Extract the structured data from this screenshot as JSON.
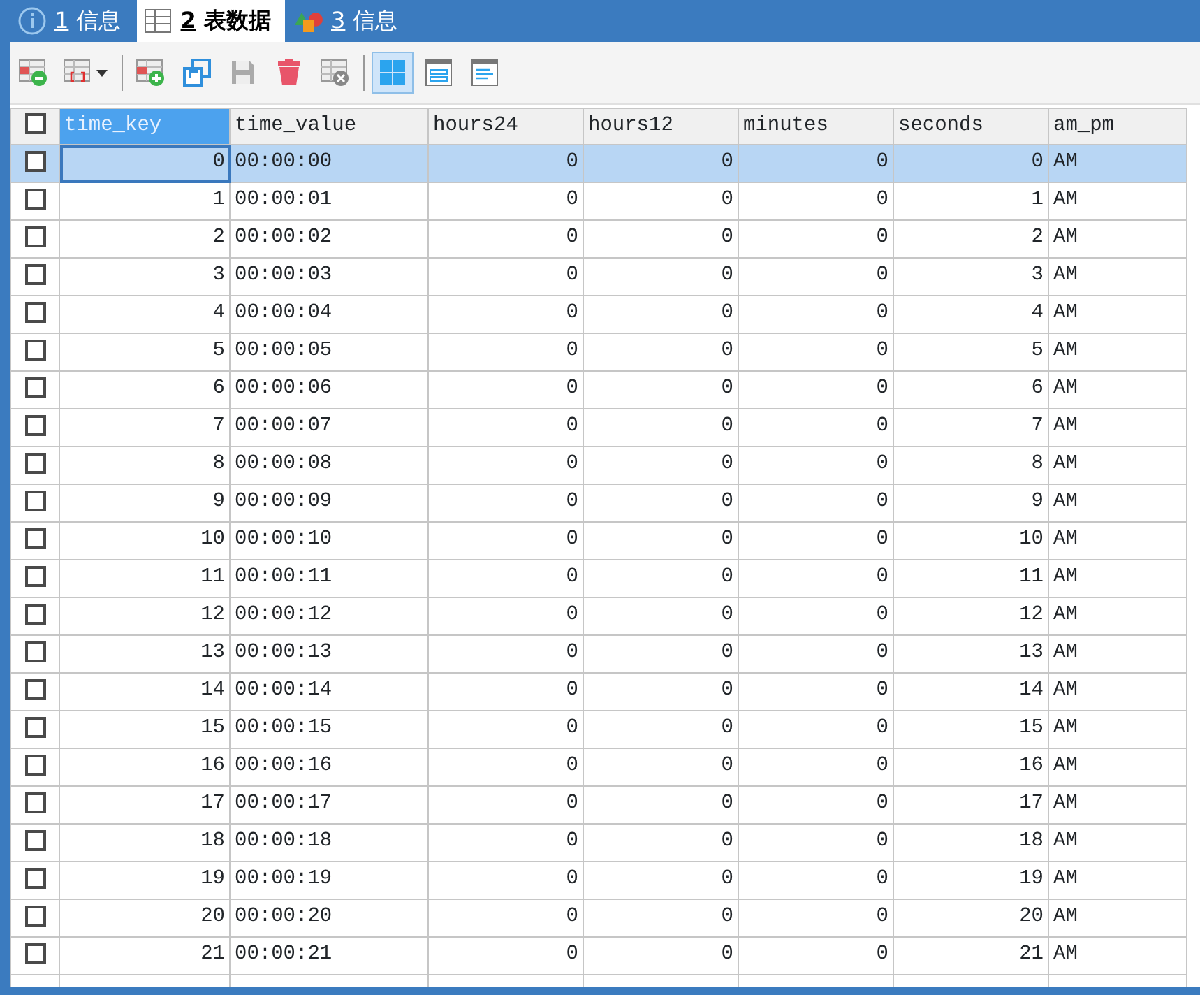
{
  "tabs": [
    {
      "number": "1",
      "label": "信息",
      "kind": "info",
      "selected": false
    },
    {
      "number": "2",
      "label": "表数据",
      "kind": "grid",
      "selected": true
    },
    {
      "number": "3",
      "label": "信息",
      "kind": "shapes",
      "selected": false
    }
  ],
  "toolbar": [
    {
      "kind": "add-record",
      "pressed": false
    },
    {
      "kind": "filter",
      "pressed": false
    },
    {
      "kind": "separator"
    },
    {
      "kind": "add",
      "pressed": false
    },
    {
      "kind": "refresh",
      "pressed": false
    },
    {
      "kind": "save",
      "pressed": false
    },
    {
      "kind": "delete",
      "pressed": false
    },
    {
      "kind": "discard",
      "pressed": false
    },
    {
      "kind": "separator"
    },
    {
      "kind": "grid-view",
      "pressed": true
    },
    {
      "kind": "form-view",
      "pressed": false
    },
    {
      "kind": "text-view",
      "pressed": false
    }
  ],
  "table": {
    "header_checked": false,
    "columns": [
      {
        "label": "time_key",
        "kind": "number",
        "selected": true
      },
      {
        "label": "time_value",
        "kind": "text",
        "selected": false
      },
      {
        "label": "hours24",
        "kind": "number",
        "selected": false
      },
      {
        "label": "hours12",
        "kind": "number",
        "selected": false
      },
      {
        "label": "minutes",
        "kind": "number",
        "selected": false
      },
      {
        "label": "seconds",
        "kind": "number",
        "selected": false
      },
      {
        "label": "am_pm",
        "kind": "text",
        "selected": false
      }
    ],
    "rows": [
      {
        "cells": [
          "0",
          "00:00:00",
          "0",
          "0",
          "0",
          "0",
          "AM"
        ],
        "checked": false,
        "selected": true
      },
      {
        "cells": [
          "1",
          "00:00:01",
          "0",
          "0",
          "0",
          "1",
          "AM"
        ],
        "checked": false,
        "selected": false
      },
      {
        "cells": [
          "2",
          "00:00:02",
          "0",
          "0",
          "0",
          "2",
          "AM"
        ],
        "checked": false,
        "selected": false
      },
      {
        "cells": [
          "3",
          "00:00:03",
          "0",
          "0",
          "0",
          "3",
          "AM"
        ],
        "checked": false,
        "selected": false
      },
      {
        "cells": [
          "4",
          "00:00:04",
          "0",
          "0",
          "0",
          "4",
          "AM"
        ],
        "checked": false,
        "selected": false
      },
      {
        "cells": [
          "5",
          "00:00:05",
          "0",
          "0",
          "0",
          "5",
          "AM"
        ],
        "checked": false,
        "selected": false
      },
      {
        "cells": [
          "6",
          "00:00:06",
          "0",
          "0",
          "0",
          "6",
          "AM"
        ],
        "checked": false,
        "selected": false
      },
      {
        "cells": [
          "7",
          "00:00:07",
          "0",
          "0",
          "0",
          "7",
          "AM"
        ],
        "checked": false,
        "selected": false
      },
      {
        "cells": [
          "8",
          "00:00:08",
          "0",
          "0",
          "0",
          "8",
          "AM"
        ],
        "checked": false,
        "selected": false
      },
      {
        "cells": [
          "9",
          "00:00:09",
          "0",
          "0",
          "0",
          "9",
          "AM"
        ],
        "checked": false,
        "selected": false
      },
      {
        "cells": [
          "10",
          "00:00:10",
          "0",
          "0",
          "0",
          "10",
          "AM"
        ],
        "checked": false,
        "selected": false
      },
      {
        "cells": [
          "11",
          "00:00:11",
          "0",
          "0",
          "0",
          "11",
          "AM"
        ],
        "checked": false,
        "selected": false
      },
      {
        "cells": [
          "12",
          "00:00:12",
          "0",
          "0",
          "0",
          "12",
          "AM"
        ],
        "checked": false,
        "selected": false
      },
      {
        "cells": [
          "13",
          "00:00:13",
          "0",
          "0",
          "0",
          "13",
          "AM"
        ],
        "checked": false,
        "selected": false
      },
      {
        "cells": [
          "14",
          "00:00:14",
          "0",
          "0",
          "0",
          "14",
          "AM"
        ],
        "checked": false,
        "selected": false
      },
      {
        "cells": [
          "15",
          "00:00:15",
          "0",
          "0",
          "0",
          "15",
          "AM"
        ],
        "checked": false,
        "selected": false
      },
      {
        "cells": [
          "16",
          "00:00:16",
          "0",
          "0",
          "0",
          "16",
          "AM"
        ],
        "checked": false,
        "selected": false
      },
      {
        "cells": [
          "17",
          "00:00:17",
          "0",
          "0",
          "0",
          "17",
          "AM"
        ],
        "checked": false,
        "selected": false
      },
      {
        "cells": [
          "18",
          "00:00:18",
          "0",
          "0",
          "0",
          "18",
          "AM"
        ],
        "checked": false,
        "selected": false
      },
      {
        "cells": [
          "19",
          "00:00:19",
          "0",
          "0",
          "0",
          "19",
          "AM"
        ],
        "checked": false,
        "selected": false
      },
      {
        "cells": [
          "20",
          "00:00:20",
          "0",
          "0",
          "0",
          "20",
          "AM"
        ],
        "checked": false,
        "selected": false
      },
      {
        "cells": [
          "21",
          "00:00:21",
          "0",
          "0",
          "0",
          "21",
          "AM"
        ],
        "checked": false,
        "selected": false
      }
    ]
  }
}
